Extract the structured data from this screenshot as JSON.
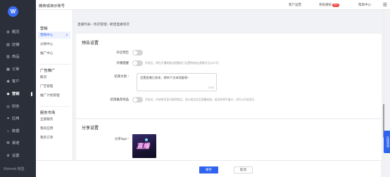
{
  "app": {
    "title": "微商城演示账号",
    "logo": "W",
    "brand": "Weimob 微盟"
  },
  "left_nav": [
    {
      "icon": "overview-icon",
      "glyph": "⊞",
      "label": "概况"
    },
    {
      "icon": "store-icon",
      "glyph": "▤",
      "label": "店铺"
    },
    {
      "icon": "goods-icon",
      "glyph": "▥",
      "label": "商品"
    },
    {
      "icon": "order-icon",
      "glyph": "▦",
      "label": "订单"
    },
    {
      "icon": "customer-icon",
      "glyph": "◉",
      "label": "客户"
    },
    {
      "icon": "marketing-icon",
      "glyph": "◈",
      "label": "营销",
      "active": true
    },
    {
      "icon": "finance-icon",
      "glyph": "◎",
      "label": "财务"
    },
    {
      "icon": "app-icon",
      "glyph": "✦",
      "label": "应用"
    },
    {
      "icon": "data-icon",
      "glyph": "⌂",
      "label": "数据"
    },
    {
      "icon": "channel-icon",
      "glyph": "⌘",
      "label": "渠道"
    },
    {
      "icon": "settings-icon",
      "glyph": "⚙",
      "label": "设置"
    }
  ],
  "sub_nav": {
    "groups": [
      {
        "header": "营销",
        "items": [
          {
            "label": "营销中心",
            "selected": true,
            "arrow": "▾"
          },
          {
            "label": "分销中心"
          },
          {
            "label": "推广中心"
          }
        ]
      },
      {
        "header": "广告推广",
        "items": [
          {
            "label": "概况"
          },
          {
            "label": "广告管理"
          },
          {
            "label": "推广计划管理"
          }
        ]
      },
      {
        "header": "服务市场",
        "items": [
          {
            "label": "全部服务"
          },
          {
            "label": "我的应用"
          },
          {
            "label": "我的订单"
          }
        ]
      }
    ]
  },
  "topbar": {
    "links": [
      "客户运营",
      "系统通知",
      "帮助中心"
    ],
    "notification_badge": "99+",
    "menu_glyph": "☰"
  },
  "breadcrumb": "直播列表 › 场次管理 › 新建直播场次",
  "preview_section": {
    "title": "预告设置",
    "rows": [
      {
        "label": "开启预告",
        "hint": ""
      },
      {
        "label": "开播提醒",
        "hint": "开启后，将在开播前推送提醒给已设置的粉丝(需要关注公众号)"
      },
      {
        "label": "结束文案",
        "required": true,
        "hint": ""
      },
      {
        "label": "结束推荐商品",
        "hint": "开启后，在结束页显示推荐商品，显示商品在页面最底部，若没有则不展示；也可以开启显示"
      }
    ],
    "end_text_value": "设置直播已结束，期待下次来观看哦~",
    "end_text_count": "17/50"
  },
  "share_section": {
    "title": "分享设置",
    "logo_label": "分享logo",
    "logo_required": true,
    "logo_text": "直播"
  },
  "footer": {
    "save_label": "保存",
    "cancel_label": "取消"
  },
  "side_help": "在线咨询"
}
